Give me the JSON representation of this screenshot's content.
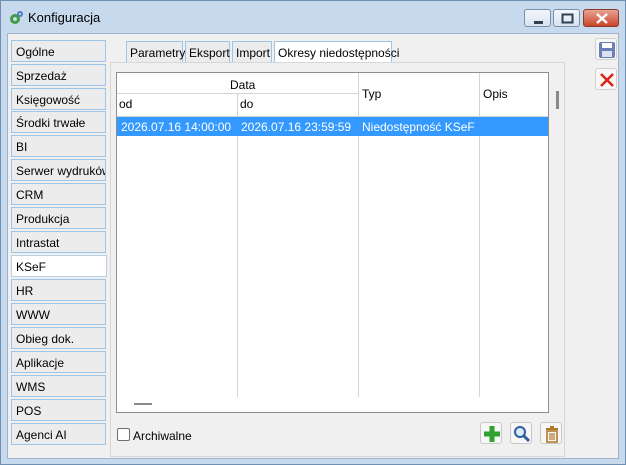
{
  "window": {
    "title": "Konfiguracja"
  },
  "left_tabs": [
    {
      "label": "Ogólne"
    },
    {
      "label": "Sprzedaż"
    },
    {
      "label": "Księgowość"
    },
    {
      "label": "Środki trwałe"
    },
    {
      "label": "BI"
    },
    {
      "label": "Serwer wydruków"
    },
    {
      "label": "CRM"
    },
    {
      "label": "Produkcja"
    },
    {
      "label": "Intrastat"
    },
    {
      "label": "KSeF",
      "active": true
    },
    {
      "label": "HR"
    },
    {
      "label": "WWW"
    },
    {
      "label": "Obieg dok."
    },
    {
      "label": "Aplikacje"
    },
    {
      "label": "WMS"
    },
    {
      "label": "POS"
    },
    {
      "label": "Agenci AI"
    }
  ],
  "top_tabs": [
    {
      "label": "Parametry"
    },
    {
      "label": "Eksport"
    },
    {
      "label": "Import"
    },
    {
      "label": "Okresy niedostępności",
      "active": true
    }
  ],
  "grid": {
    "group_header": "Data",
    "columns": {
      "od": "od",
      "do": "do",
      "typ": "Typ",
      "opis": "Opis"
    },
    "rows": [
      {
        "od": "2026.07.16 14:00:00",
        "do": "2026.07.16 23:59:59",
        "typ": "Niedostępność KSeF",
        "opis": "",
        "selected": true
      }
    ]
  },
  "archive": {
    "label": "Archiwalne",
    "checked": false
  },
  "actions": {
    "add_icon": "plus-icon",
    "search_icon": "magnifier-icon",
    "delete_icon": "trash-icon"
  },
  "side_actions": {
    "save_icon": "floppy-disk-icon",
    "cancel_icon": "red-x-icon"
  },
  "colors": {
    "selection": "#3399ff",
    "add_green": "#2ea12e",
    "cancel_red": "#d9261c"
  }
}
